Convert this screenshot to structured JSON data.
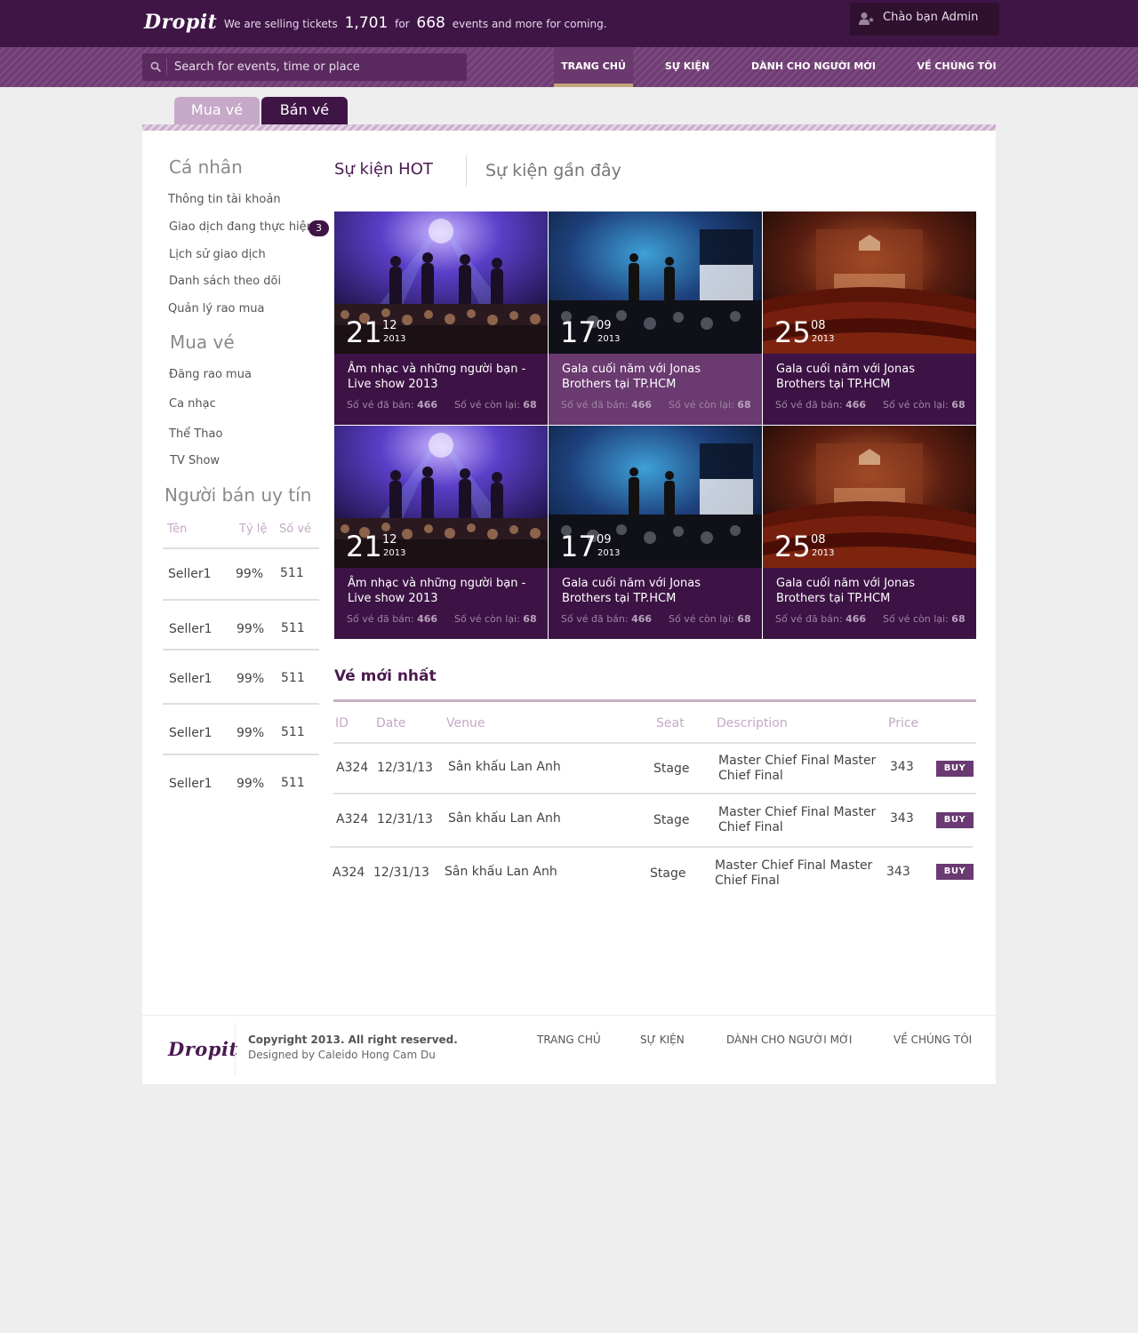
{
  "brand": {
    "logo": "Dropit"
  },
  "header": {
    "tagline_prefix": "We are selling tickets",
    "tickets_count": "1,701",
    "tagline_for": "for",
    "events_count": "668",
    "tagline_suffix": "events and more for coming.",
    "user_greeting": "Chào bạn Admin"
  },
  "search": {
    "placeholder": "Search for events, time or place"
  },
  "nav": [
    {
      "label": "TRANG CHỦ"
    },
    {
      "label": "SỰ KIỆN"
    },
    {
      "label": "DÀNH CHO NGƯỜI MỚI"
    },
    {
      "label": "VỀ CHÚNG TÔI"
    }
  ],
  "tabs": {
    "buy": "Mua vé",
    "sell": "Bán vé"
  },
  "sidebar": {
    "personal_title": "Cá nhân",
    "personal_items": [
      {
        "label": "Thông tin tài khoản"
      },
      {
        "label": "Giao dịch đang thực hiện",
        "badge": "3"
      },
      {
        "label": "Lịch sử giao dịch"
      },
      {
        "label": "Danh sách theo dõi"
      },
      {
        "label": "Quản lý rao mua"
      }
    ],
    "buy_title": "Mua vé",
    "buy_items": [
      {
        "label": "Đăng rao mua"
      },
      {
        "label": "Ca nhạc"
      },
      {
        "label": "Thể Thao"
      },
      {
        "label": "TV Show"
      }
    ],
    "sellers_title": "Người bán uy tín",
    "sellers_headers": {
      "name": "Tên",
      "rate": "Tỷ lệ",
      "count": "Số vé"
    },
    "sellers": [
      {
        "name": "Seller1",
        "rate": "99%",
        "count": "511"
      },
      {
        "name": "Seller1",
        "rate": "99%",
        "count": "511"
      },
      {
        "name": "Seller1",
        "rate": "99%",
        "count": "511"
      },
      {
        "name": "Seller1",
        "rate": "99%",
        "count": "511"
      },
      {
        "name": "Seller1",
        "rate": "99%",
        "count": "511"
      }
    ]
  },
  "main_tabs": {
    "hot": "Sự kiện HOT",
    "recent": "Sự kiện gần đây"
  },
  "events": [
    {
      "day": "21",
      "month": "12",
      "year": "2013",
      "title": "Âm nhạc và những người bạn - Live show 2013",
      "sold_label": "Số vé đã bán:",
      "sold": "466",
      "left_label": "Số vé còn lại:",
      "left": "68"
    },
    {
      "day": "17",
      "month": "09",
      "year": "2013",
      "title": "Gala cuối năm với Jonas Brothers tại TP.HCM",
      "sold_label": "Số vé đã bán:",
      "sold": "466",
      "left_label": "Số vé còn lại:",
      "left": "68"
    },
    {
      "day": "25",
      "month": "08",
      "year": "2013",
      "title": "Gala cuối năm với Jonas Brothers tại TP.HCM",
      "sold_label": "Số vé đã bán:",
      "sold": "466",
      "left_label": "Số vé còn lại:",
      "left": "68"
    },
    {
      "day": "21",
      "month": "12",
      "year": "2013",
      "title": "Âm nhạc và những người bạn - Live show 2013",
      "sold_label": "Số vé đã bán:",
      "sold": "466",
      "left_label": "Số vé còn lại:",
      "left": "68"
    },
    {
      "day": "17",
      "month": "09",
      "year": "2013",
      "title": "Gala cuối năm với Jonas Brothers tại TP.HCM",
      "sold_label": "Số vé đã bán:",
      "sold": "466",
      "left_label": "Số vé còn lại:",
      "left": "68"
    },
    {
      "day": "25",
      "month": "08",
      "year": "2013",
      "title": "Gala cuối năm với Jonas Brothers tại TP.HCM",
      "sold_label": "Số vé đã bán:",
      "sold": "466",
      "left_label": "Số vé còn lại:",
      "left": "68"
    }
  ],
  "tickets": {
    "title": "Vé mới nhất",
    "headers": {
      "id": "ID",
      "date": "Date",
      "venue": "Venue",
      "seat": "Seat",
      "description": "Description",
      "price": "Price"
    },
    "rows": [
      {
        "id": "A324",
        "date": "12/31/13",
        "venue": "Sân khấu Lan Anh",
        "seat": "Stage",
        "description": "Master Chief Final Master Chief Final",
        "price": "343",
        "action": "BUY"
      },
      {
        "id": "A324",
        "date": "12/31/13",
        "venue": "Sân khấu Lan Anh",
        "seat": "Stage",
        "description": "Master Chief Final Master Chief Final",
        "price": "343",
        "action": "BUY"
      },
      {
        "id": "A324",
        "date": "12/31/13",
        "venue": "Sân khấu Lan Anh",
        "seat": "Stage",
        "description": "Master Chief Final Master Chief Final",
        "price": "343",
        "action": "BUY"
      }
    ]
  },
  "footer": {
    "copyright": "Copyright 2013. All right reserved.",
    "designer": "Designed by Caleido Hong Cam Du",
    "links": [
      {
        "label": "TRANG CHỦ"
      },
      {
        "label": "SỰ KIỆN"
      },
      {
        "label": "DÀNH CHO NGƯỜI MỚI"
      },
      {
        "label": "VỀ CHÚNG TÔI"
      }
    ]
  }
}
